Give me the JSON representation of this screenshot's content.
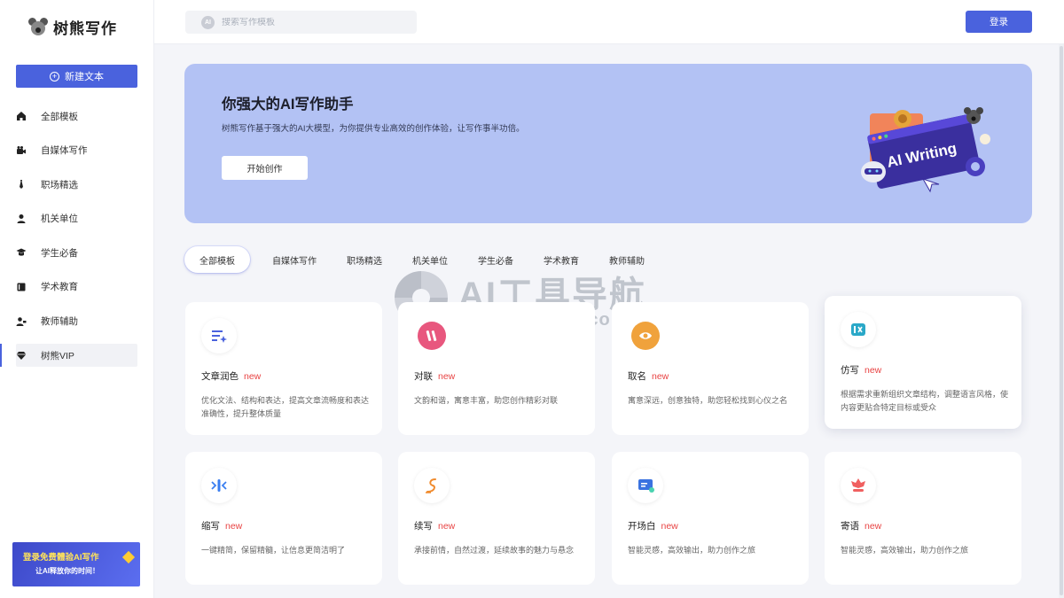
{
  "sidebar": {
    "logo_text": "树熊写作",
    "new_button": "新建文本",
    "items": [
      {
        "label": "全部模板",
        "icon": "home-icon"
      },
      {
        "label": "自媒体写作",
        "icon": "camera-icon"
      },
      {
        "label": "职场精选",
        "icon": "tie-icon"
      },
      {
        "label": "机关单位",
        "icon": "person-icon"
      },
      {
        "label": "学生必备",
        "icon": "student-icon"
      },
      {
        "label": "学术教育",
        "icon": "book-icon"
      },
      {
        "label": "教师辅助",
        "icon": "teacher-icon"
      },
      {
        "label": "树熊VIP",
        "icon": "diamond-icon"
      }
    ],
    "promo": {
      "line1": "登录免费體验AI写作",
      "line2": "让AI释放你的时间！"
    }
  },
  "header": {
    "search_placeholder": "搜索写作模板",
    "search_icon_text": "AI",
    "login": "登录"
  },
  "hero": {
    "title": "你强大的AI写作助手",
    "subtitle": "树熊写作基于强大的AI大模型，为你提供专业高效的创作体验，让写作事半功倍。",
    "start": "开始创作",
    "art_text": "AI Writing"
  },
  "tabs": [
    "全部模板",
    "自媒体写作",
    "职场精选",
    "机关单位",
    "学生必备",
    "学术教育",
    "教师辅助"
  ],
  "watermark": {
    "title": "AI工具导航",
    "url": "aitools123.com"
  },
  "cards": [
    {
      "title": "文章润色",
      "badge": "new",
      "desc": "优化文法、结构和表达，提高文章流畅度和表达准确性，提升整体质量",
      "icon": "polish-icon",
      "color": "#4a62dd"
    },
    {
      "title": "对联",
      "badge": "new",
      "desc": "文韵和谐，寓意丰富，助您创作精彩对联",
      "icon": "couplet-icon",
      "color": "#e8577e"
    },
    {
      "title": "取名",
      "badge": "new",
      "desc": "寓意深远，创意独特，助您轻松找到心仪之名",
      "icon": "naming-icon",
      "color": "#f0a23c"
    },
    {
      "title": "仿写",
      "badge": "new",
      "desc": "根据需求重新组织文章结构，调整语言风格，使内容更贴合特定目标或受众",
      "icon": "imitate-icon",
      "color": "#2aa8c8"
    },
    {
      "title": "缩写",
      "badge": "new",
      "desc": "一键精简，保留精髓，让信息更简洁明了",
      "icon": "abbreviate-icon",
      "color": "#3a7ef0"
    },
    {
      "title": "续写",
      "badge": "new",
      "desc": "承接前情，自然过渡，延续故事的魅力与悬念",
      "icon": "continue-icon",
      "color": "#f08a2c"
    },
    {
      "title": "开场白",
      "badge": "new",
      "desc": "智能灵感，高效输出，助力创作之旅",
      "icon": "opening-icon",
      "color": "#3a72e0"
    },
    {
      "title": "寄语",
      "badge": "new",
      "desc": "智能灵感，高效输出，助力创作之旅",
      "icon": "flower-icon",
      "color": "#f06060"
    }
  ]
}
